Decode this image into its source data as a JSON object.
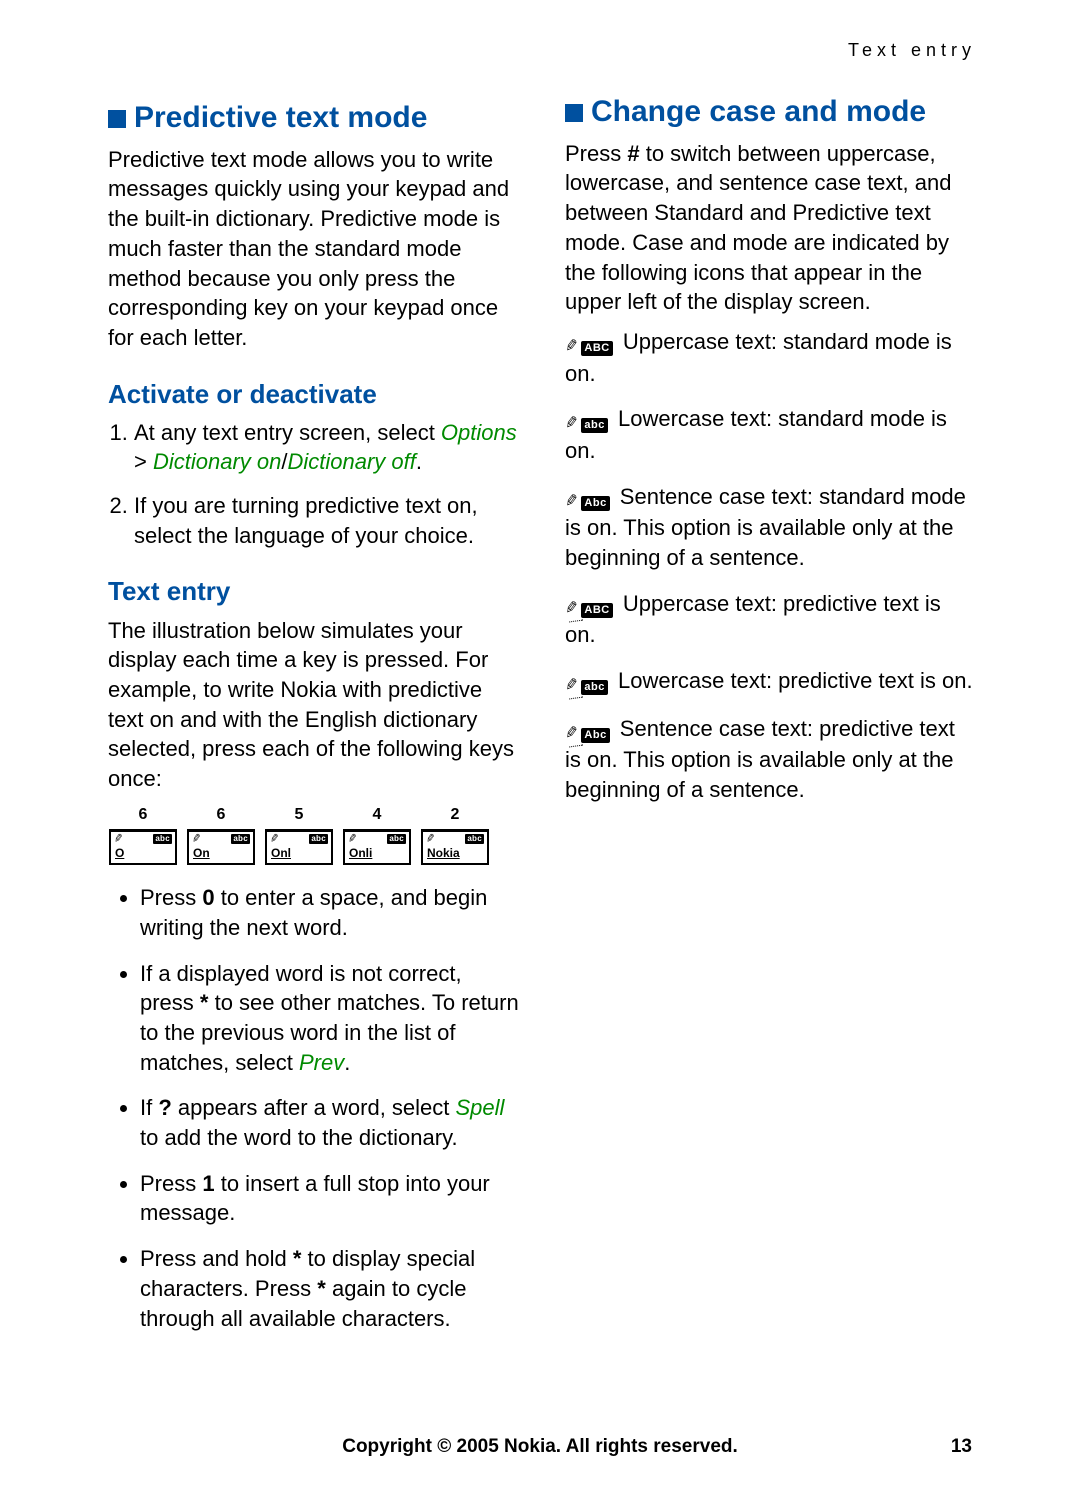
{
  "running_head": "Text entry",
  "section1": {
    "title": "Predictive text mode",
    "intro": "Predictive text mode allows you to write messages quickly using your keypad and the built-in dictionary. Predictive mode is much faster than the standard mode method because you only press the corresponding key on your keypad once for each letter."
  },
  "activate": {
    "heading": "Activate or deactivate",
    "step1_pre": "At any text entry screen, select ",
    "step1_opt": "Options",
    "step1_gt": " > ",
    "step1_dict": "Dictionary on",
    "step1_slash": "/",
    "step1_dictoff": "Dictionary off",
    "step1_post": ".",
    "step2": "If you are turning predictive text on, select the language of your choice."
  },
  "textentry": {
    "heading": "Text entry",
    "intro": "The illustration below simulates your display each time a key is pressed. For example, to write Nokia with predictive text on and with the English dictionary selected, press each of the following keys once:",
    "keys": [
      {
        "num": "6",
        "word": "O"
      },
      {
        "num": "6",
        "word": "On"
      },
      {
        "num": "5",
        "word": "Onl"
      },
      {
        "num": "4",
        "word": "Onli"
      },
      {
        "num": "2",
        "word": "Nokia"
      }
    ],
    "abc_chip": "abc",
    "b1_pre": "Press ",
    "b1_key": "0",
    "b1_post": " to enter a space, and begin writing the next word.",
    "b2_pre": "If a displayed word is not correct, press ",
    "b2_key": "*",
    "b2_mid": " to see other matches. To return to the previous word in the list of matches, select ",
    "b2_prev": "Prev",
    "b2_post": ".",
    "b3_pre": "If ",
    "b3_q": "?",
    "b3_mid": " appears after a word, select ",
    "b3_spell": "Spell",
    "b3_post": " to add the word to the dictionary.",
    "b4_pre": "Press ",
    "b4_key": "1",
    "b4_post": " to insert a full stop into your message.",
    "b5_pre": "Press and hold ",
    "b5_key1": "*",
    "b5_mid": " to display special characters. Press ",
    "b5_key2": "*",
    "b5_post": " again to cycle through all available characters."
  },
  "section2": {
    "title": "Change case and mode",
    "p_pre": "Press ",
    "p_key": "#",
    "p_post": " to switch between uppercase, lowercase, and sentence case text, and between Standard and Predictive text mode. Case and mode are indicated by the following icons that appear in the upper left of the display screen.",
    "modes": [
      {
        "pred": false,
        "chip": "ABC",
        "text": " Uppercase text: standard mode is on."
      },
      {
        "pred": false,
        "chip": "abc",
        "text": " Lowercase text: standard mode is on."
      },
      {
        "pred": false,
        "chip": "Abc",
        "text": " Sentence case text: standard mode is on. This option is available only at the beginning of a sentence."
      },
      {
        "pred": true,
        "chip": "ABC",
        "text": " Uppercase text: predictive text is on."
      },
      {
        "pred": true,
        "chip": "abc",
        "text": " Lowercase text: predictive text is on."
      },
      {
        "pred": true,
        "chip": "Abc",
        "text": " Sentence case text: predictive text is on. This option is available only at the beginning of a sentence."
      }
    ]
  },
  "footer": {
    "copyright": "Copyright © 2005 Nokia. All rights reserved.",
    "pageno": "13"
  }
}
